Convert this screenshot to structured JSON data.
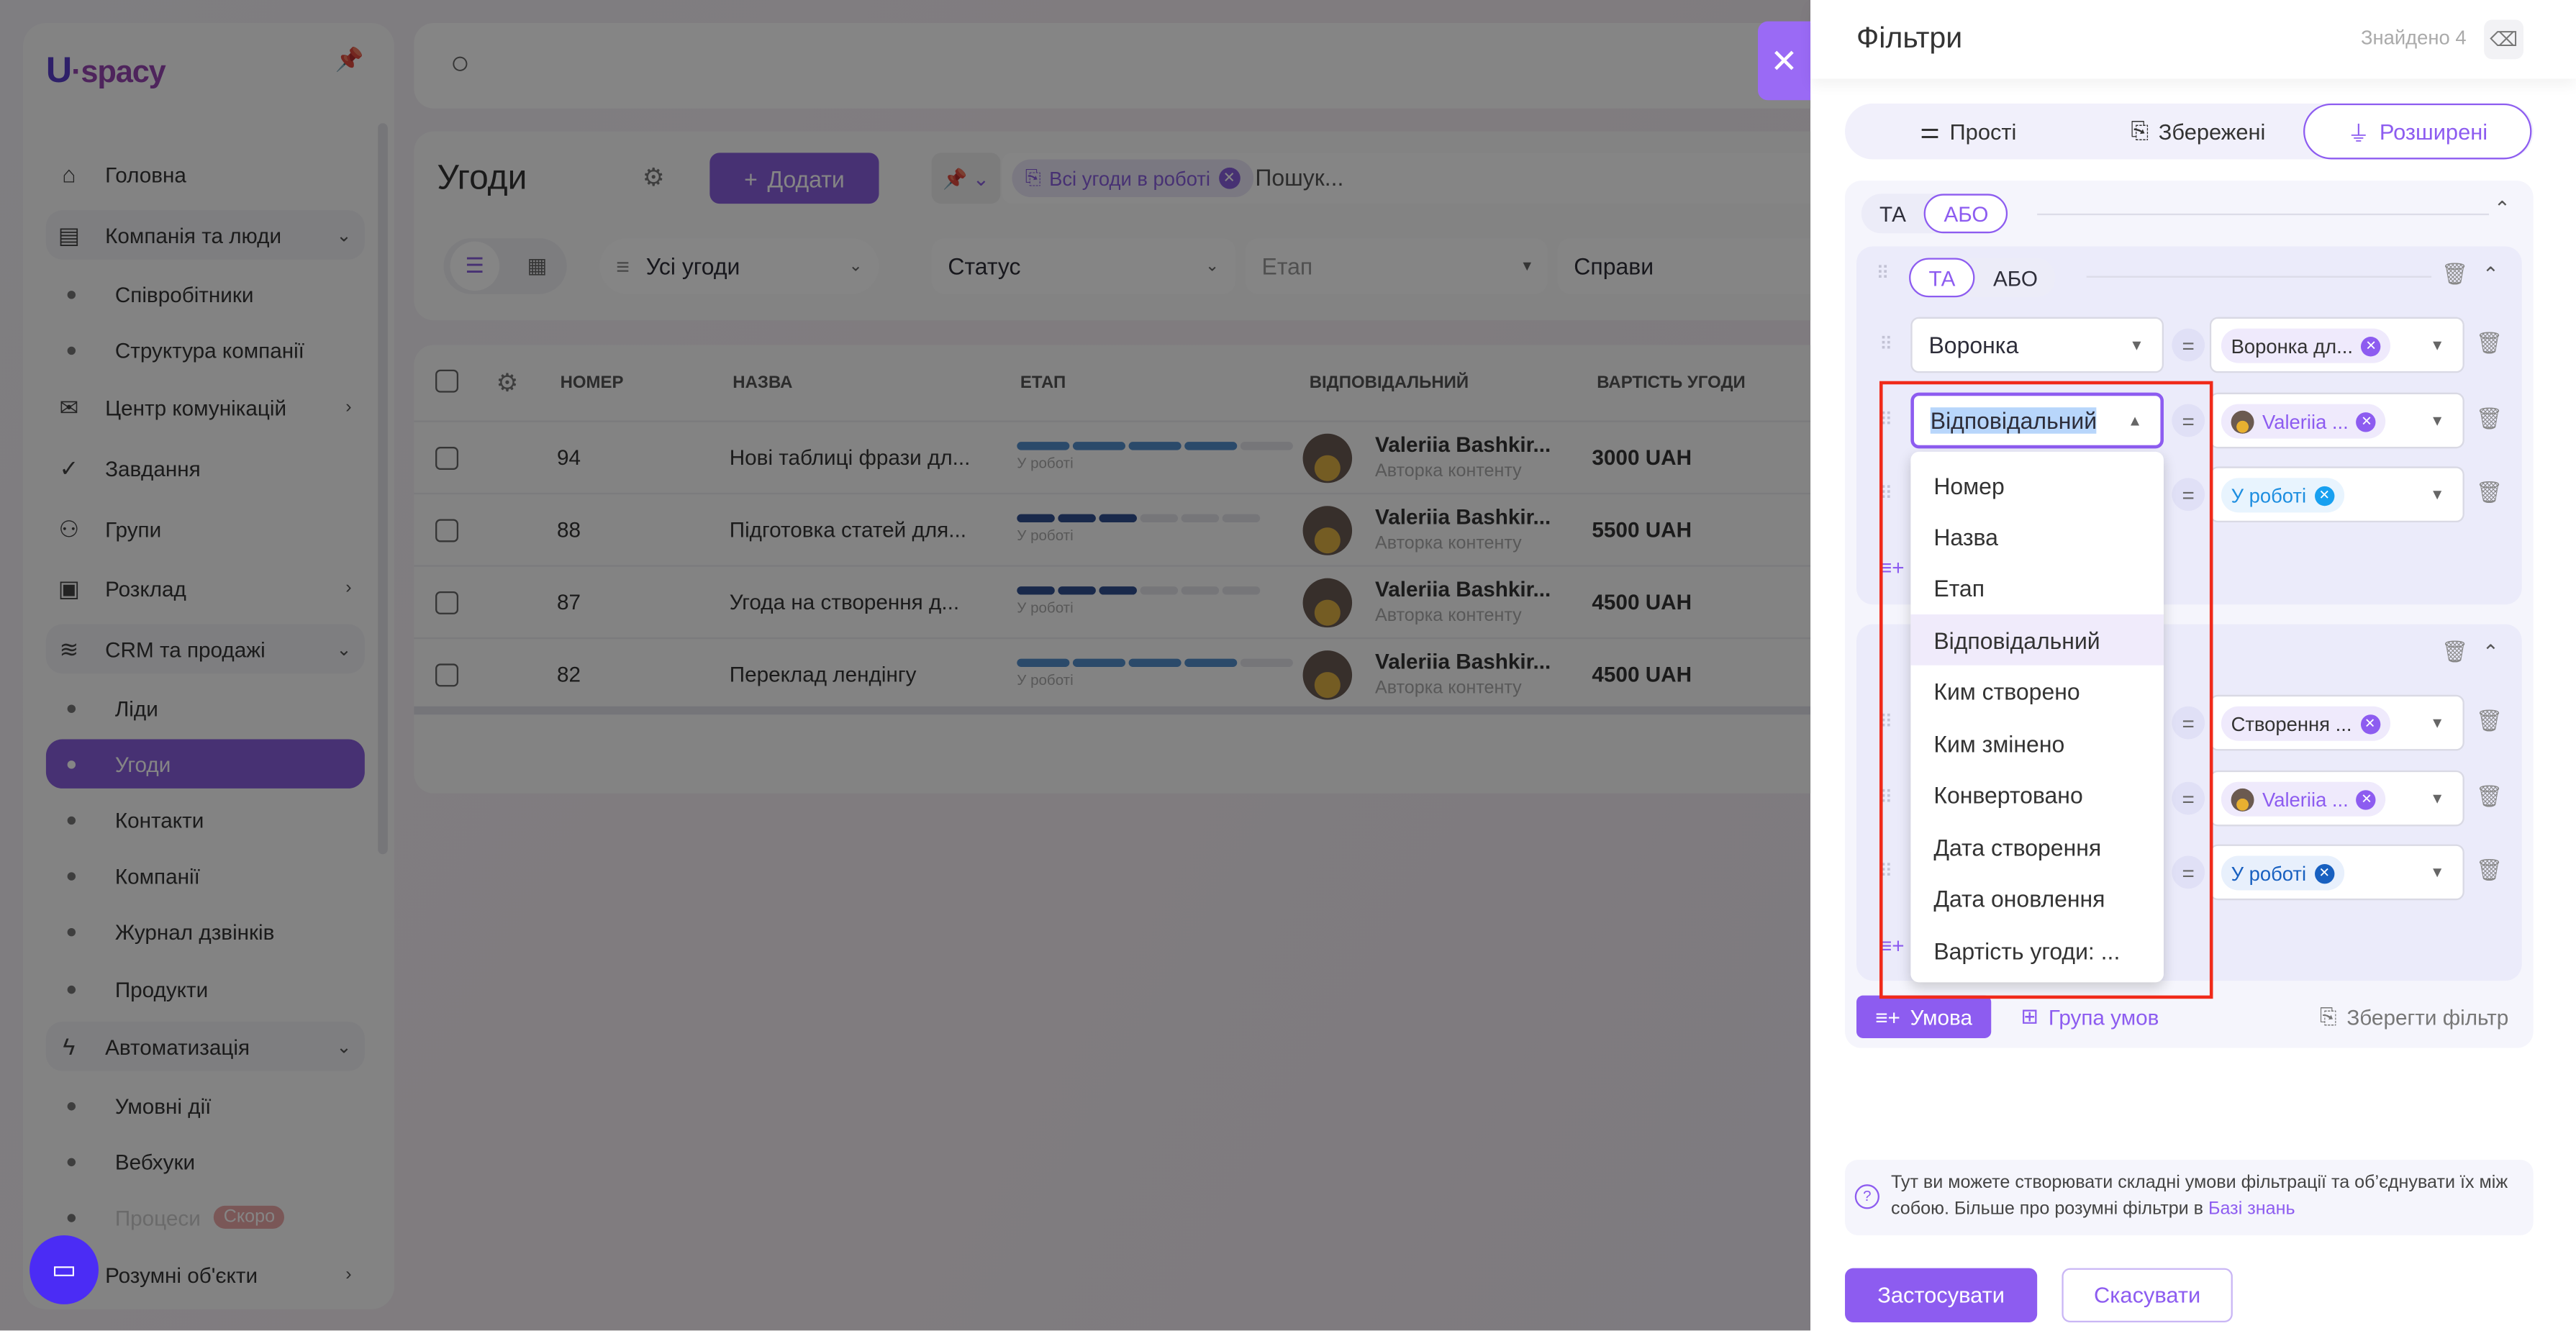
{
  "app": {
    "logo": "Uspacy"
  },
  "sidebar": {
    "items": [
      {
        "label": "Головна",
        "type": "top",
        "icon": "home-icon"
      },
      {
        "label": "Компанія та люди",
        "type": "group",
        "icon": "building-icon",
        "chev": "⌄"
      },
      {
        "label": "Співробітники",
        "type": "sub"
      },
      {
        "label": "Структура компанії",
        "type": "sub"
      },
      {
        "label": "Центр комунікацій",
        "type": "top",
        "icon": "chat-icon",
        "chev": "›"
      },
      {
        "label": "Завдання",
        "type": "top",
        "icon": "task-icon"
      },
      {
        "label": "Групи",
        "type": "top",
        "icon": "users-icon"
      },
      {
        "label": "Розклад",
        "type": "top",
        "icon": "calendar-icon",
        "chev": "›"
      },
      {
        "label": "CRM та продажі",
        "type": "group",
        "icon": "crm-icon",
        "chev": "⌄"
      },
      {
        "label": "Ліди",
        "type": "sub"
      },
      {
        "label": "Угоди",
        "type": "sub",
        "active": true
      },
      {
        "label": "Контакти",
        "type": "sub"
      },
      {
        "label": "Компанії",
        "type": "sub"
      },
      {
        "label": "Журнал дзвінків",
        "type": "sub"
      },
      {
        "label": "Продукти",
        "type": "sub"
      },
      {
        "label": "Автоматизація",
        "type": "group",
        "icon": "lightning-icon",
        "chev": "⌄"
      },
      {
        "label": "Умовні дії",
        "type": "sub"
      },
      {
        "label": "Вебхуки",
        "type": "sub"
      },
      {
        "label": "Процеси",
        "type": "sub",
        "disabled": true,
        "badge": "Скоро"
      },
      {
        "label": "Розумні об'єкти",
        "type": "top",
        "icon": "cube-icon",
        "chev": "›"
      }
    ]
  },
  "header": {
    "title": "Угоди",
    "add_label": "Додати",
    "saved_filter_chip": "Всі угоди в роботі",
    "search_placeholder": "Пошук...",
    "view_select": "Усі угоди",
    "filters": [
      "Статус",
      "Етап",
      "Справи"
    ]
  },
  "table": {
    "columns": [
      "НОМЕР",
      "НАЗВА",
      "ЕТАП",
      "ВІДПОВІДАЛЬНИЙ",
      "ВАРТІСТЬ УГОДИ"
    ],
    "rows": [
      {
        "number": "94",
        "name": "Нові таблиці фрази дл...",
        "stage": "У роботі",
        "stage_progress": [
          4,
          5
        ],
        "stage_color": "#4a8fd8",
        "owner": "Valeriia Bashkir...",
        "owner_role": "Авторка контенту",
        "amount": "3000 UAH"
      },
      {
        "number": "88",
        "name": "Підготовка статей для...",
        "stage": "У роботі",
        "stage_progress": [
          3,
          6
        ],
        "stage_color": "#2c4f9c",
        "owner": "Valeriia Bashkir...",
        "owner_role": "Авторка контенту",
        "amount": "5500 UAH"
      },
      {
        "number": "87",
        "name": "Угода на створення д...",
        "stage": "У роботі",
        "stage_progress": [
          3,
          6
        ],
        "stage_color": "#2c4f9c",
        "owner": "Valeriia Bashkir...",
        "owner_role": "Авторка контенту",
        "amount": "4500 UAH"
      },
      {
        "number": "82",
        "name": "Переклад лендінгу",
        "stage": "У роботі",
        "stage_progress": [
          4,
          5
        ],
        "stage_color": "#4a8fd8",
        "owner": "Valeriia Bashkir...",
        "owner_role": "Авторка контенту",
        "amount": "4500 UAH"
      }
    ]
  },
  "panel": {
    "title": "Фільтри",
    "found": "Знайдено 4",
    "tabs": [
      "Прості",
      "Збережені",
      "Розширені"
    ],
    "active_tab": "Розширені",
    "and": "ТА",
    "or": "АБО",
    "group1": {
      "rows": [
        {
          "field": "Воронка",
          "value": "Воронка дл...",
          "style": "plain"
        },
        {
          "field": "Відповідальний",
          "value": "Valeriia ...",
          "style": "avatar"
        },
        {
          "field": "",
          "value": "У роботі",
          "style": "blue"
        }
      ]
    },
    "group2": {
      "rows": [
        {
          "value": "Створення ...",
          "style": "plain"
        },
        {
          "value": "Valeriia ...",
          "style": "avatar"
        },
        {
          "value": "У роботі",
          "style": "dblue"
        }
      ]
    },
    "dropdown_options": [
      "Номер",
      "Назва",
      "Етап",
      "Відповідальний",
      "Ким створено",
      "Ким змінено",
      "Конвертовано",
      "Дата створення",
      "Дата оновлення",
      "Вартість угоди: ..."
    ],
    "hovered_option": "Відповідальний",
    "add_condition": "Умова",
    "add_group": "Група умов",
    "save_filter": "Зберегти фільтр",
    "info_text": "Тут ви можете створювати складні умови фільтрації та об’єднувати їх між собою. Більше про розумні фільтри в ",
    "info_link": "Базі знань",
    "apply": "Застосувати",
    "cancel": "Скасувати"
  },
  "colors": {
    "accent": "#8d5cf0",
    "highlight": "#f02a1a"
  }
}
